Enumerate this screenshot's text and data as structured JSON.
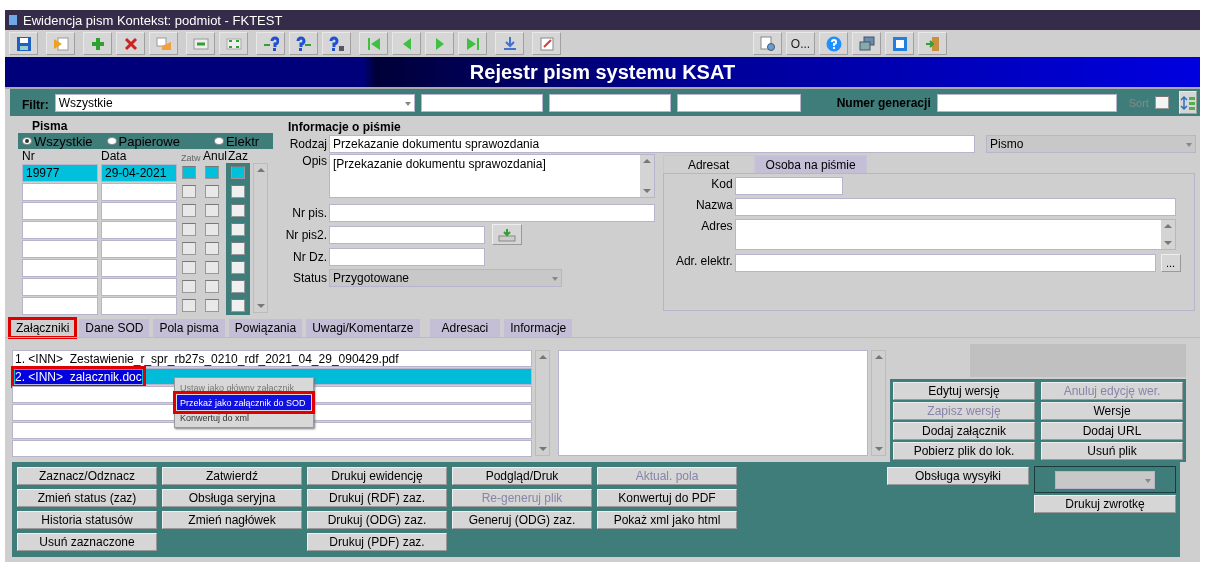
{
  "window": {
    "title": "Ewidencja pism Kontekst: podmiot - FKTEST"
  },
  "toolbar": {
    "more_label": "O..."
  },
  "banner": {
    "title": "Rejestr pism systemu KSAT"
  },
  "filter": {
    "label": "Filtr:",
    "value": "Wszystkie",
    "generation_label": "Numer generacji",
    "sort_label": "Sort",
    "sort_checked": false
  },
  "pisma": {
    "title": "Pisma",
    "radios": [
      {
        "label": "Wszystkie",
        "selected": true
      },
      {
        "label": "Papierowe",
        "selected": false
      },
      {
        "label": "Elektr",
        "selected": false
      }
    ],
    "columns": [
      "Nr",
      "Data",
      "Zatw",
      "Anul",
      "Zaz"
    ],
    "rows": [
      {
        "nr": "19977",
        "data": "29-04-2021",
        "selected": true,
        "zatw": false,
        "anul": false,
        "zaz": false
      },
      {
        "selected": false,
        "zatw": false,
        "anul": false,
        "zaz": false
      },
      {
        "selected": false,
        "zatw": false,
        "anul": false,
        "zaz": false
      },
      {
        "selected": false,
        "zatw": false,
        "anul": false,
        "zaz": false
      },
      {
        "selected": false,
        "zatw": false,
        "anul": false,
        "zaz": false
      },
      {
        "selected": false,
        "zatw": false,
        "anul": false,
        "zaz": false
      },
      {
        "selected": false,
        "zatw": false,
        "anul": false,
        "zaz": false
      },
      {
        "selected": false,
        "zatw": false,
        "anul": false,
        "zaz": false
      }
    ]
  },
  "info": {
    "title": "Informacje o piśmie",
    "rodzaj": {
      "label": "Rodzaj",
      "value": "Przekazanie dokumentu sprawozdania"
    },
    "typ": {
      "value": "Pismo"
    },
    "opis": {
      "label": "Opis",
      "value": "[Przekazanie dokumentu sprawozdania]"
    },
    "nr_pis": {
      "label": "Nr pis."
    },
    "nr_pis2": {
      "label": "Nr pis2."
    },
    "nr_dz": {
      "label": "Nr Dz."
    },
    "status": {
      "label": "Status",
      "value": "Przygotowane"
    }
  },
  "adresat": {
    "tabs": [
      {
        "label": "Adresat",
        "selected": true
      },
      {
        "label": "Osoba na piśmie",
        "selected": false
      }
    ],
    "fields": [
      {
        "label": "Kod",
        "kind": "short"
      },
      {
        "label": "Nazwa",
        "kind": "line"
      },
      {
        "label": "Adres",
        "kind": "area"
      },
      {
        "label": "Adr. elektr.",
        "kind": "lookup",
        "button": "..."
      }
    ]
  },
  "tabs": [
    {
      "label": "Załączniki",
      "selected": true,
      "highlighted": true
    },
    {
      "label": "Dane SOD",
      "selected": false,
      "highlighted": false
    },
    {
      "label": "Pola pisma",
      "selected": false,
      "highlighted": false
    },
    {
      "label": "Powiązania",
      "selected": false,
      "highlighted": false
    },
    {
      "label": "Uwagi/Komentarze",
      "selected": false,
      "highlighted": false
    },
    {
      "label": "Adresaci",
      "selected": false,
      "highlighted": false
    },
    {
      "label": "Informacje",
      "selected": false,
      "highlighted": false
    }
  ],
  "attachments": [
    {
      "text": "1. <INN>  Zestawienie_r_spr_rb27s_0210_rdf_2021_04_29_090429.pdf",
      "selected": false,
      "highlighted": false
    },
    {
      "text": "2. <INN>  zalacznik.doc",
      "selected": true,
      "highlighted": true
    },
    {
      "selected": false
    },
    {
      "selected": false
    },
    {
      "selected": false
    },
    {
      "selected": false
    }
  ],
  "context_menu": [
    {
      "label": "Ustaw jako główny załącznik",
      "selected": false,
      "disabled": true,
      "highlighted": false
    },
    {
      "label": "Przekaż jako załącznik do SOD",
      "selected": true,
      "disabled": false,
      "highlighted": true
    },
    {
      "label": "Konwertuj do xml",
      "selected": false,
      "disabled": false,
      "highlighted": false
    }
  ],
  "version_buttons": [
    {
      "label": "Edytuj wersję",
      "disabled": false
    },
    {
      "label": "Anuluj edycję wer.",
      "disabled": true
    },
    {
      "label": "Zapisz wersję",
      "disabled": true
    },
    {
      "label": "Wersje",
      "disabled": false
    },
    {
      "label": "Dodaj załącznik",
      "disabled": false
    },
    {
      "label": "Dodaj URL",
      "disabled": false
    },
    {
      "label": "Pobierz plik do lok.",
      "disabled": false
    },
    {
      "label": "Usuń plik",
      "disabled": false
    }
  ],
  "action_columns": [
    [
      {
        "label": "Zaznacz/Odznacz",
        "disabled": false
      },
      {
        "label": "Zmień status (zaz)",
        "disabled": false
      },
      {
        "label": "Historia statusów",
        "disabled": false
      },
      {
        "label": "Usuń zaznaczone",
        "disabled": false
      }
    ],
    [
      {
        "label": "Zatwierdź",
        "disabled": false
      },
      {
        "label": "Obsługa seryjna",
        "disabled": false
      },
      {
        "label": "Zmień nagłówek",
        "disabled": false
      }
    ],
    [
      {
        "label": "Drukuj ewidencję",
        "disabled": false
      },
      {
        "label": "Drukuj (RDF) zaz.",
        "disabled": false
      },
      {
        "label": "Drukuj (ODG) zaz.",
        "disabled": false
      },
      {
        "label": "Drukuj (PDF) zaz.",
        "disabled": false
      }
    ],
    [
      {
        "label": "Podgląd/Druk",
        "disabled": false
      },
      {
        "label": "Re-generuj plik",
        "disabled": true
      },
      {
        "label": "Generuj (ODG) zaz.",
        "disabled": false
      }
    ],
    [
      {
        "label": "Aktual. pola",
        "disabled": true
      },
      {
        "label": "Konwertuj do PDF",
        "disabled": false
      },
      {
        "label": "Pokaż xml jako html",
        "disabled": false
      }
    ]
  ],
  "shipping": {
    "button": {
      "label": "Obsługa wysyłki",
      "disabled": false
    },
    "print_button": {
      "label": "Drukuj zwrotkę",
      "disabled": false
    }
  }
}
